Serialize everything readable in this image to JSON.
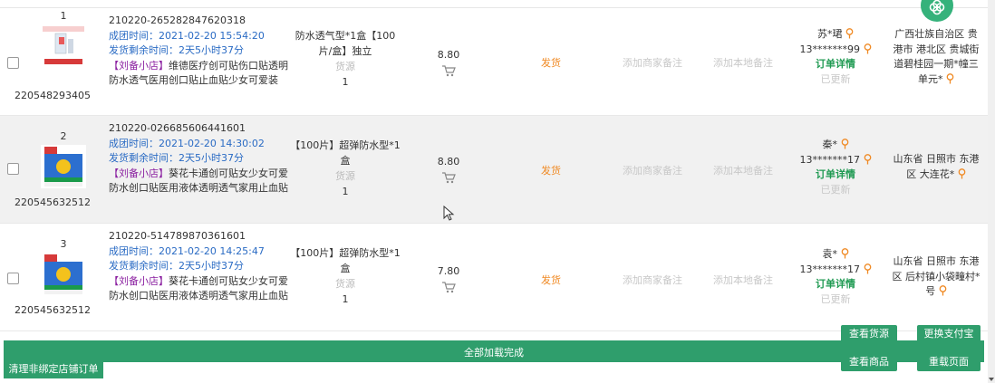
{
  "orders": [
    {
      "index": "1",
      "product_id": "220548293405",
      "order_no": "210220-265282847620318",
      "created": "成团时间：2021-02-20 15:54:20",
      "remain": "发货剩余时间：2天5小时37分",
      "shop": "【刘备小店】",
      "title": "维德医疗创可贴伤口贴透明防水透气医用创口贴止血贴少女可爱装",
      "spec_line1": "防水透气型*1盒【100",
      "spec_line2": "片/盒】独立",
      "source": "货源",
      "qty": "1",
      "price": "8.80",
      "ship": "发货",
      "merchant_memo": "添加商家备注",
      "local_memo": "添加本地备注",
      "buyer_name": "苏*珺",
      "buyer_phone": "13*******99",
      "detail": "订单详情",
      "updated": "已更新",
      "address_lines": [
        "广西壮族自治区 贵",
        "港市 港北区 贵城街",
        "道碧桂园一期*幢三",
        "单元*"
      ]
    },
    {
      "index": "2",
      "product_id": "220545632512",
      "order_no": "210220-026685606441601",
      "created": "成团时间：2021-02-20 14:30:02",
      "remain": "发货剩余时间：2天5小时37分",
      "shop": "【刘备小店】",
      "title": "葵花卡通创可贴女少女可爱防水创口贴医用液体透明透气家用止血贴",
      "spec_line1": "【100片】超弹防水型*1",
      "spec_line2": "盒",
      "source": "货源",
      "qty": "1",
      "price": "8.80",
      "ship": "发货",
      "merchant_memo": "添加商家备注",
      "local_memo": "添加本地备注",
      "buyer_name": "秦*",
      "buyer_phone": "13*******17",
      "detail": "订单详情",
      "updated": "已更新",
      "address_lines": [
        "山东省 日照市 东港",
        "区 大连花*"
      ]
    },
    {
      "index": "3",
      "product_id": "220545632512",
      "order_no": "210220-514789870361601",
      "created": "成团时间：2021-02-20 14:25:47",
      "remain": "发货剩余时间：2天5小时37分",
      "shop": "【刘备小店】",
      "title": "葵花卡通创可贴女少女可爱防水创口贴医用液体透明透气家用止血贴",
      "spec_line1": "【100片】超弹防水型*1",
      "spec_line2": "盒",
      "source": "货源",
      "qty": "1",
      "price": "7.80",
      "ship": "发货",
      "merchant_memo": "添加商家备注",
      "local_memo": "添加本地备注",
      "buyer_name": "袁*",
      "buyer_phone": "13*******17",
      "detail": "订单详情",
      "updated": "已更新",
      "address_lines": [
        "山东省 日照市 东港",
        "区 后村镇小袋疃村*",
        "号"
      ]
    }
  ],
  "footer": {
    "loaded_msg": "全部加载完成",
    "clean_unbound": "清理非绑定店铺订单",
    "view_source": "查看货源",
    "change_alipay": "更换支付宝",
    "view_product": "查看商品",
    "reload_page": "重载页面"
  },
  "colors": {
    "accent_green": "#2f9e6c",
    "ship_orange": "#f08a24",
    "link_blue": "#2a6bc4",
    "shop_purple": "#8a1fa0"
  },
  "icons": [
    "cart-icon",
    "location-pin-icon",
    "clover-icon",
    "mouse-cursor-icon"
  ]
}
